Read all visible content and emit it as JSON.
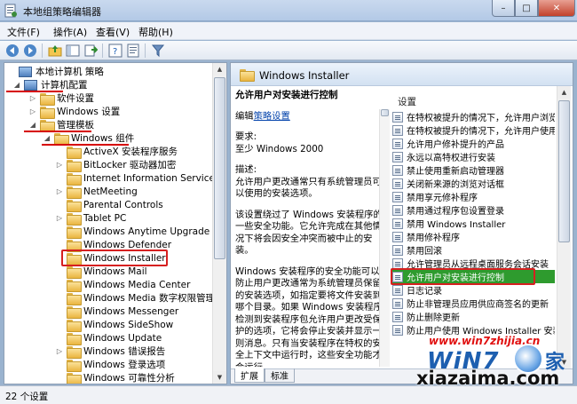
{
  "window": {
    "title": "本地组策略编辑器",
    "controls": {
      "minimize": "–",
      "maximize": "□",
      "close": "✕"
    }
  },
  "menu": [
    "文件(F)",
    "操作(A)",
    "查看(V)",
    "帮助(H)"
  ],
  "toolbar": {
    "icons": [
      "back-arrow-icon",
      "forward-arrow-icon",
      "up-folder-icon",
      "show-tree-icon",
      "export-icon",
      "help-icon",
      "properties-icon",
      "filter-icon"
    ]
  },
  "tree": [
    {
      "label": "本地计算机 策略",
      "level": 0,
      "expander": "",
      "icon": "computer-policy-icon",
      "annot": ""
    },
    {
      "label": "计算机配置",
      "level": 1,
      "expander": "◢",
      "icon": "computer-icon",
      "annot": "underline"
    },
    {
      "label": "软件设置",
      "level": 2,
      "expander": "▷",
      "icon": "folder-icon",
      "annot": ""
    },
    {
      "label": "Windows 设置",
      "level": 2,
      "expander": "▷",
      "icon": "folder-icon",
      "annot": ""
    },
    {
      "label": "管理模板",
      "level": 2,
      "expander": "◢",
      "icon": "folder-icon",
      "annot": "underline"
    },
    {
      "label": "Windows 组件",
      "level": 3,
      "expander": "◢",
      "icon": "folder-open-icon",
      "annot": "underline"
    },
    {
      "label": "ActiveX 安装程序服务",
      "level": 4,
      "expander": "",
      "icon": "folder-icon",
      "annot": ""
    },
    {
      "label": "BitLocker 驱动器加密",
      "level": 4,
      "expander": "▷",
      "icon": "folder-icon",
      "annot": ""
    },
    {
      "label": "Internet Information Services",
      "level": 4,
      "expander": "",
      "icon": "folder-icon",
      "annot": ""
    },
    {
      "label": "NetMeeting",
      "level": 4,
      "expander": "▷",
      "icon": "folder-icon",
      "annot": ""
    },
    {
      "label": "Parental Controls",
      "level": 4,
      "expander": "",
      "icon": "folder-icon",
      "annot": ""
    },
    {
      "label": "Tablet PC",
      "level": 4,
      "expander": "▷",
      "icon": "folder-icon",
      "annot": ""
    },
    {
      "label": "Windows Anytime Upgrade",
      "level": 4,
      "expander": "",
      "icon": "folder-icon",
      "annot": ""
    },
    {
      "label": "Windows Defender",
      "level": 4,
      "expander": "",
      "icon": "folder-icon",
      "annot": ""
    },
    {
      "label": "Windows Installer",
      "level": 4,
      "expander": "",
      "icon": "folder-icon",
      "annot": "box"
    },
    {
      "label": "Windows Mail",
      "level": 4,
      "expander": "",
      "icon": "folder-icon",
      "annot": ""
    },
    {
      "label": "Windows Media Center",
      "level": 4,
      "expander": "",
      "icon": "folder-icon",
      "annot": ""
    },
    {
      "label": "Windows Media 数字权限管理",
      "level": 4,
      "expander": "",
      "icon": "folder-icon",
      "annot": ""
    },
    {
      "label": "Windows Messenger",
      "level": 4,
      "expander": "",
      "icon": "folder-icon",
      "annot": ""
    },
    {
      "label": "Windows SideShow",
      "level": 4,
      "expander": "",
      "icon": "folder-icon",
      "annot": ""
    },
    {
      "label": "Windows Update",
      "level": 4,
      "expander": "",
      "icon": "folder-icon",
      "annot": ""
    },
    {
      "label": "Windows 错误报告",
      "level": 4,
      "expander": "▷",
      "icon": "folder-icon",
      "annot": ""
    },
    {
      "label": "Windows 登录选项",
      "level": 4,
      "expander": "",
      "icon": "folder-icon",
      "annot": ""
    },
    {
      "label": "Windows 可靠性分析",
      "level": 4,
      "expander": "",
      "icon": "folder-icon",
      "annot": ""
    }
  ],
  "detail": {
    "header": "Windows Installer",
    "policy_title": "允许用户对安装进行控制",
    "edit_prefix": "编辑",
    "edit_link": "策略设置",
    "req_label": "要求:",
    "req_value": "至少 Windows 2000",
    "desc_label": "描述:",
    "para1": "允许用户更改通常只有系统管理员可以使用的安装选项。",
    "para2": "该设置绕过了 Windows 安装程序的一些安全功能。它允许完成在其他情况下将会因安全冲突而被中止的安装。",
    "para3": "Windows 安装程序的安全功能可以防止用户更改通常为系统管理员保留的安装选项，如指定要将文件安装到哪个目录。如果 Windows 安装程序检测到安装程序包允许用户更改受保护的选项，它将会停止安装并显示一则消息。只有当安装程序在特权的安全上下文中运行时，这些安全功能才会运行。"
  },
  "settings": {
    "header": "设置",
    "items": [
      "在特权被提升的情况下，允许用户浏览",
      "在特权被提升的情况下，允许用户使用",
      "允许用户修补提升的产品",
      "永远以高特权进行安装",
      "禁止使用重新启动管理器",
      "关闭新来源的浏览对话框",
      "禁用享元修补程序",
      "禁用通过程序包设置登录",
      "禁用 Windows Installer",
      "禁用修补程序",
      "禁用回滚",
      "允许管理员从远程桌面服务会话安装",
      "允许用户对安装进行控制",
      "日志记录",
      "防止非管理员应用供应商签名的更新",
      "防止删除更新",
      "防止用户使用 Windows Installer 安装"
    ],
    "selected_index": 12
  },
  "tabs": [
    "扩展",
    "标准"
  ],
  "status": "22 个设置",
  "watermark": {
    "site": "www.win7zhijia.cn",
    "brand": "WiN7",
    "logo_char": "家",
    "bottom": "xiazaima.com"
  }
}
